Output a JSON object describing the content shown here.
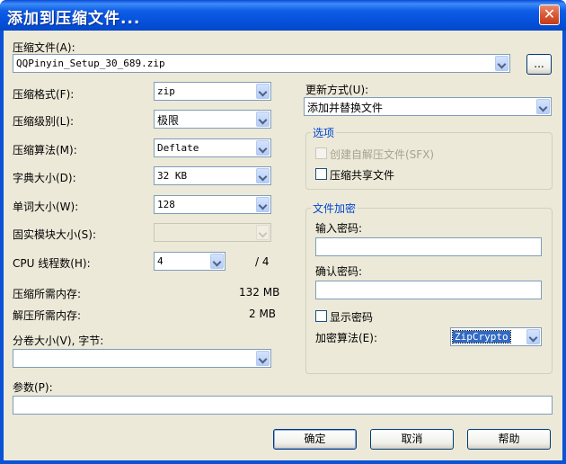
{
  "window": {
    "title": "添加到压缩文件...",
    "close_glyph": "✕"
  },
  "archive": {
    "label": "压缩文件(A):",
    "value": "QQPinyin_Setup_30_689.zip",
    "browse_label": "..."
  },
  "left": {
    "format": {
      "label": "压缩格式(F):",
      "value": "zip"
    },
    "level": {
      "label": "压缩级别(L):",
      "value": "极限"
    },
    "method": {
      "label": "压缩算法(M):",
      "value": "Deflate"
    },
    "dict": {
      "label": "字典大小(D):",
      "value": "32 KB"
    },
    "word": {
      "label": "单词大小(W):",
      "value": "128"
    },
    "solid": {
      "label": "固实模块大小(S):",
      "value": ""
    },
    "threads": {
      "label": "CPU 线程数(H):",
      "value": "4",
      "max": "/ 4"
    },
    "mem_comp": {
      "label": "压缩所需内存:",
      "value": "132 MB"
    },
    "mem_decomp": {
      "label": "解压所需内存:",
      "value": "2 MB"
    },
    "volume": {
      "label": "分卷大小(V), 字节:",
      "value": ""
    }
  },
  "params": {
    "label": "参数(P):",
    "value": ""
  },
  "right": {
    "update": {
      "label": "更新方式(U):",
      "value": "添加并替换文件"
    },
    "options": {
      "title": "选项",
      "sfx": {
        "label": "创建自解压文件(SFX)"
      },
      "shared": {
        "label": "压缩共享文件"
      }
    },
    "encryption": {
      "title": "文件加密",
      "password_label": "输入密码:",
      "confirm_label": "确认密码:",
      "show_label": "显示密码",
      "method_label": "加密算法(E):",
      "method_value": "ZipCrypto"
    }
  },
  "buttons": {
    "ok": "确定",
    "cancel": "取消",
    "help": "帮助"
  }
}
